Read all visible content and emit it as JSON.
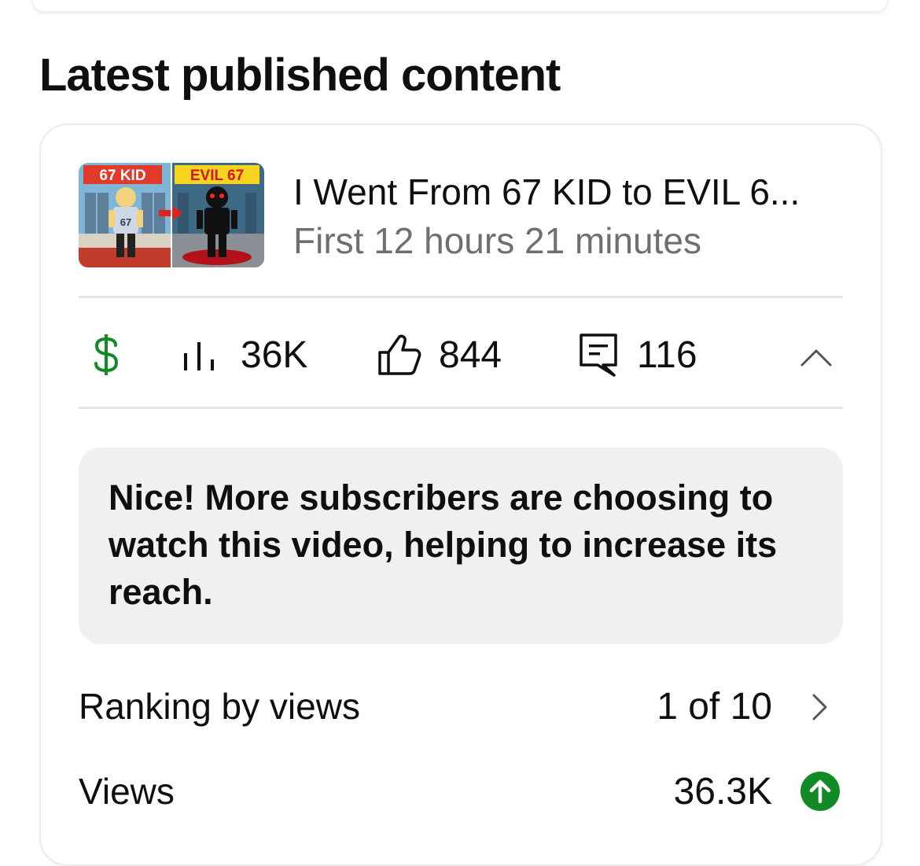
{
  "section": {
    "title": "Latest published content"
  },
  "video": {
    "thumbnail": {
      "left_label": "67 KID",
      "right_label": "EVIL 67",
      "shirt_text": "67"
    },
    "title": "I Went From 67 KID to EVIL 6...",
    "subtitle": "First 12 hours 21 minutes"
  },
  "stats": {
    "revenue_icon": "dollar-icon",
    "revenue_color": "#128a25",
    "views": "36K",
    "likes": "844",
    "comments": "116"
  },
  "message": {
    "text": "Nice! More subscribers are choosing to watch this video, helping to increase its reach."
  },
  "ranking": {
    "label": "Ranking by views",
    "value": "1 of 10"
  },
  "views_row": {
    "label": "Views",
    "value": "36.3K",
    "trend_color": "#128a25"
  }
}
